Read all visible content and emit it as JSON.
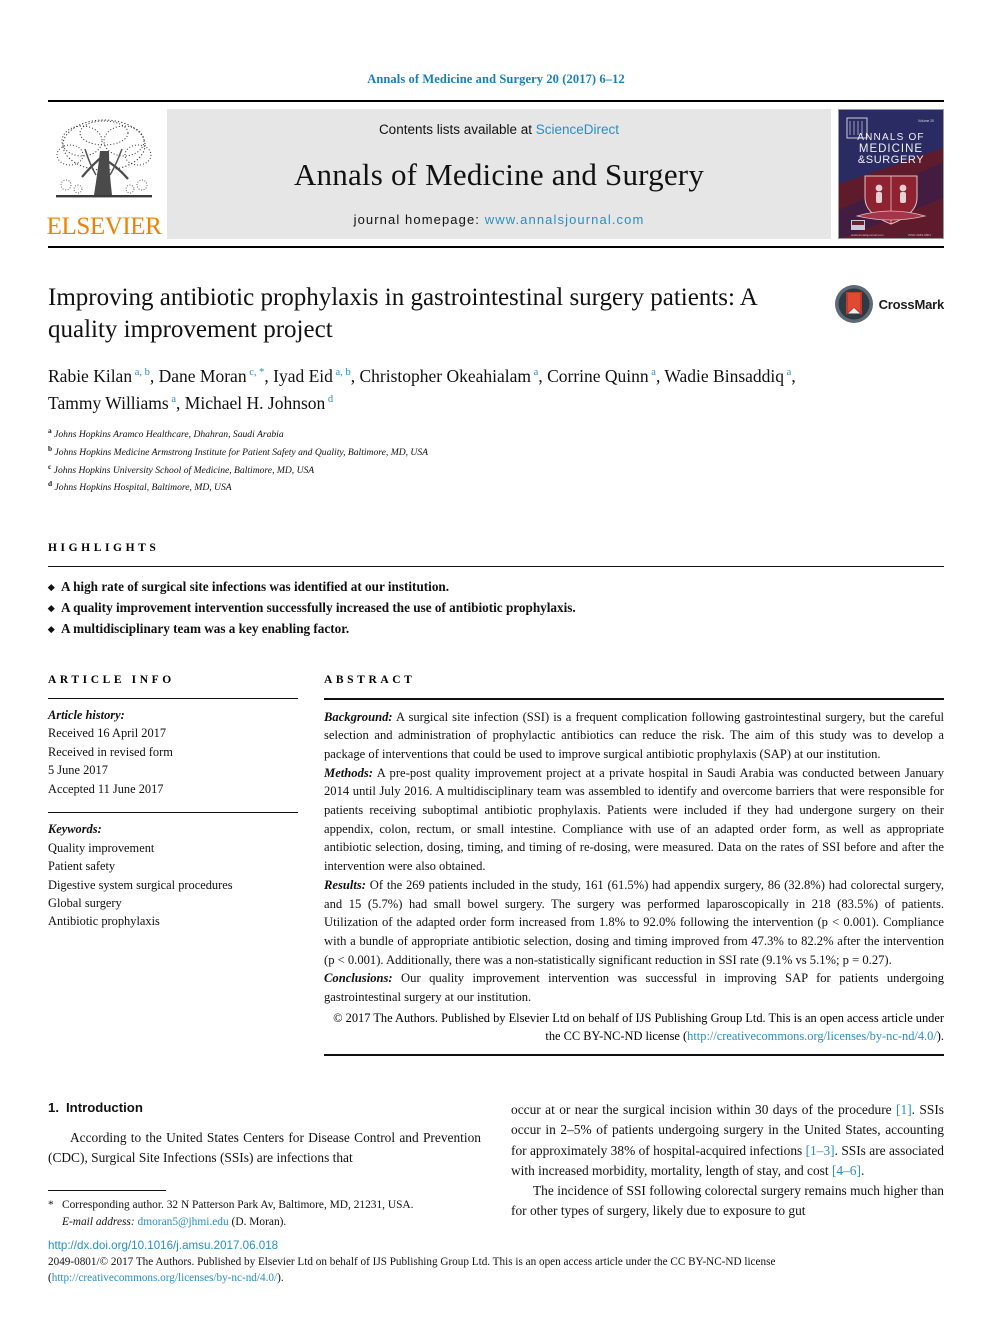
{
  "running_head": "Annals of Medicine and Surgery 20 (2017) 6–12",
  "masthead": {
    "publisher_logo_text": "ELSEVIER",
    "contents_prefix": "Contents lists available at ",
    "contents_link": "ScienceDirect",
    "journal_name": "Annals of Medicine and Surgery",
    "homepage_prefix": "journal homepage: ",
    "homepage_link": "www.annalsjournal.com",
    "cover": {
      "line1": "ANNALS OF",
      "line2": "MEDICINE",
      "line3": "& SURGERY",
      "corner_note": "Volume 20",
      "url_note": "www.annalsjournal.com",
      "issn_note": "ISSN 2049-0801"
    }
  },
  "article": {
    "title": "Improving antibiotic prophylaxis in gastrointestinal surgery patients: A quality improvement project",
    "crossmark_label": "CrossMark",
    "authors": [
      {
        "name": "Rabie Kilan",
        "marks": "a, b",
        "sep": ", "
      },
      {
        "name": "Dane Moran",
        "marks": "c, *",
        "sep": ", "
      },
      {
        "name": "Iyad Eid",
        "marks": "a, b",
        "sep": ", "
      },
      {
        "name": "Christopher Okeahialam",
        "marks": "a",
        "sep": ", "
      },
      {
        "name": "Corrine Quinn",
        "marks": "a",
        "sep": ", "
      },
      {
        "name": "Wadie Binsaddiq",
        "marks": "a",
        "sep": ", "
      },
      {
        "name": "Tammy Williams",
        "marks": "a",
        "sep": ", "
      },
      {
        "name": "Michael H. Johnson",
        "marks": "d",
        "sep": ""
      }
    ],
    "affiliations": [
      {
        "mark": "a",
        "text": "Johns Hopkins Aramco Healthcare, Dhahran, Saudi Arabia"
      },
      {
        "mark": "b",
        "text": "Johns Hopkins Medicine Armstrong Institute for Patient Safety and Quality, Baltimore, MD, USA"
      },
      {
        "mark": "c",
        "text": "Johns Hopkins University School of Medicine, Baltimore, MD, USA"
      },
      {
        "mark": "d",
        "text": "Johns Hopkins Hospital, Baltimore, MD, USA"
      }
    ]
  },
  "highlights": {
    "label": "HIGHLIGHTS",
    "items": [
      "A high rate of surgical site infections was identified at our institution.",
      "A quality improvement intervention successfully increased the use of antibiotic prophylaxis.",
      "A multidisciplinary team was a key enabling factor."
    ]
  },
  "article_info": {
    "label": "ARTICLE INFO",
    "history_label": "Article history:",
    "history": [
      "Received 16 April 2017",
      "Received in revised form",
      "5 June 2017",
      "Accepted 11 June 2017"
    ],
    "keywords_label": "Keywords:",
    "keywords": [
      "Quality improvement",
      "Patient safety",
      "Digestive system surgical procedures",
      "Global surgery",
      "Antibiotic prophylaxis"
    ]
  },
  "abstract": {
    "label": "ABSTRACT",
    "sections": [
      {
        "lead": "Background:",
        "text": " A surgical site infection (SSI) is a frequent complication following gastrointestinal surgery, but the careful selection and administration of prophylactic antibiotics can reduce the risk. The aim of this study was to develop a package of interventions that could be used to improve surgical antibiotic prophylaxis (SAP) at our institution."
      },
      {
        "lead": "Methods:",
        "text": " A pre-post quality improvement project at a private hospital in Saudi Arabia was conducted between January 2014 until July 2016. A multidisciplinary team was assembled to identify and overcome barriers that were responsible for patients receiving suboptimal antibiotic prophylaxis. Patients were included if they had undergone surgery on their appendix, colon, rectum, or small intestine. Compliance with use of an adapted order form, as well as appropriate antibiotic selection, dosing, timing, and timing of re-dosing, were measured. Data on the rates of SSI before and after the intervention were also obtained."
      },
      {
        "lead": "Results:",
        "text": " Of the 269 patients included in the study, 161 (61.5%) had appendix surgery, 86 (32.8%) had colorectal surgery, and 15 (5.7%) had small bowel surgery. The surgery was performed laparoscopically in 218 (83.5%) of patients. Utilization of the adapted order form increased from 1.8% to 92.0% following the intervention (p < 0.001). Compliance with a bundle of appropriate antibiotic selection, dosing and timing improved from 47.3% to 82.2% after the intervention (p < 0.001). Additionally, there was a non-statistically significant reduction in SSI rate (9.1% vs 5.1%; p = 0.27)."
      },
      {
        "lead": "Conclusions:",
        "text": " Our quality improvement intervention was successful in improving SAP for patients undergoing gastrointestinal surgery at our institution."
      }
    ],
    "copyright_text": "© 2017 The Authors. Published by Elsevier Ltd on behalf of IJS Publishing Group Ltd. This is an open access article under the CC BY-NC-ND license (",
    "copyright_link": "http://creativecommons.org/licenses/by-nc-nd/4.0/",
    "copyright_tail": ")."
  },
  "introduction": {
    "number": "1.",
    "title": "Introduction",
    "col_left_p1": "According to the United States Centers for Disease Control and Prevention (CDC), Surgical Site Infections (SSIs) are infections that",
    "col_right_p1_a": "occur at or near the surgical incision within 30 days of the procedure ",
    "col_right_ref1": "[1]",
    "col_right_p1_b": ". SSIs occur in 2–5% of patients undergoing surgery in the United States, accounting for approximately 38% of hospital-acquired infections ",
    "col_right_ref2": "[1–3]",
    "col_right_p1_c": ". SSIs are associated with increased morbidity, mortality, length of stay, and cost ",
    "col_right_ref3": "[4–6]",
    "col_right_p1_d": ".",
    "col_right_p2": "The incidence of SSI following colorectal surgery remains much higher than for other types of surgery, likely due to exposure to gut"
  },
  "footnote": {
    "star": "*",
    "corresponding": "Corresponding author. 32 N Patterson Park Av, Baltimore, MD, 21231, USA.",
    "email_label": "E-mail address:",
    "email": "dmoran5@jhmi.edu",
    "email_suffix": " (D. Moran)."
  },
  "footer": {
    "doi": "http://dx.doi.org/10.1016/j.amsu.2017.06.018",
    "issn_prefix": "2049-0801/© 2017 The Authors. Published by Elsevier Ltd on behalf of IJS Publishing Group Ltd. This is an open access article under the CC BY-NC-ND license (",
    "issn_link": "http://creativecommons.org/licenses/by-nc-nd/4.0/",
    "issn_tail": ")."
  },
  "colors": {
    "link": "#2a8ec4",
    "elsevier_orange": "#f28000",
    "band_gray": "#e6e6e6"
  }
}
